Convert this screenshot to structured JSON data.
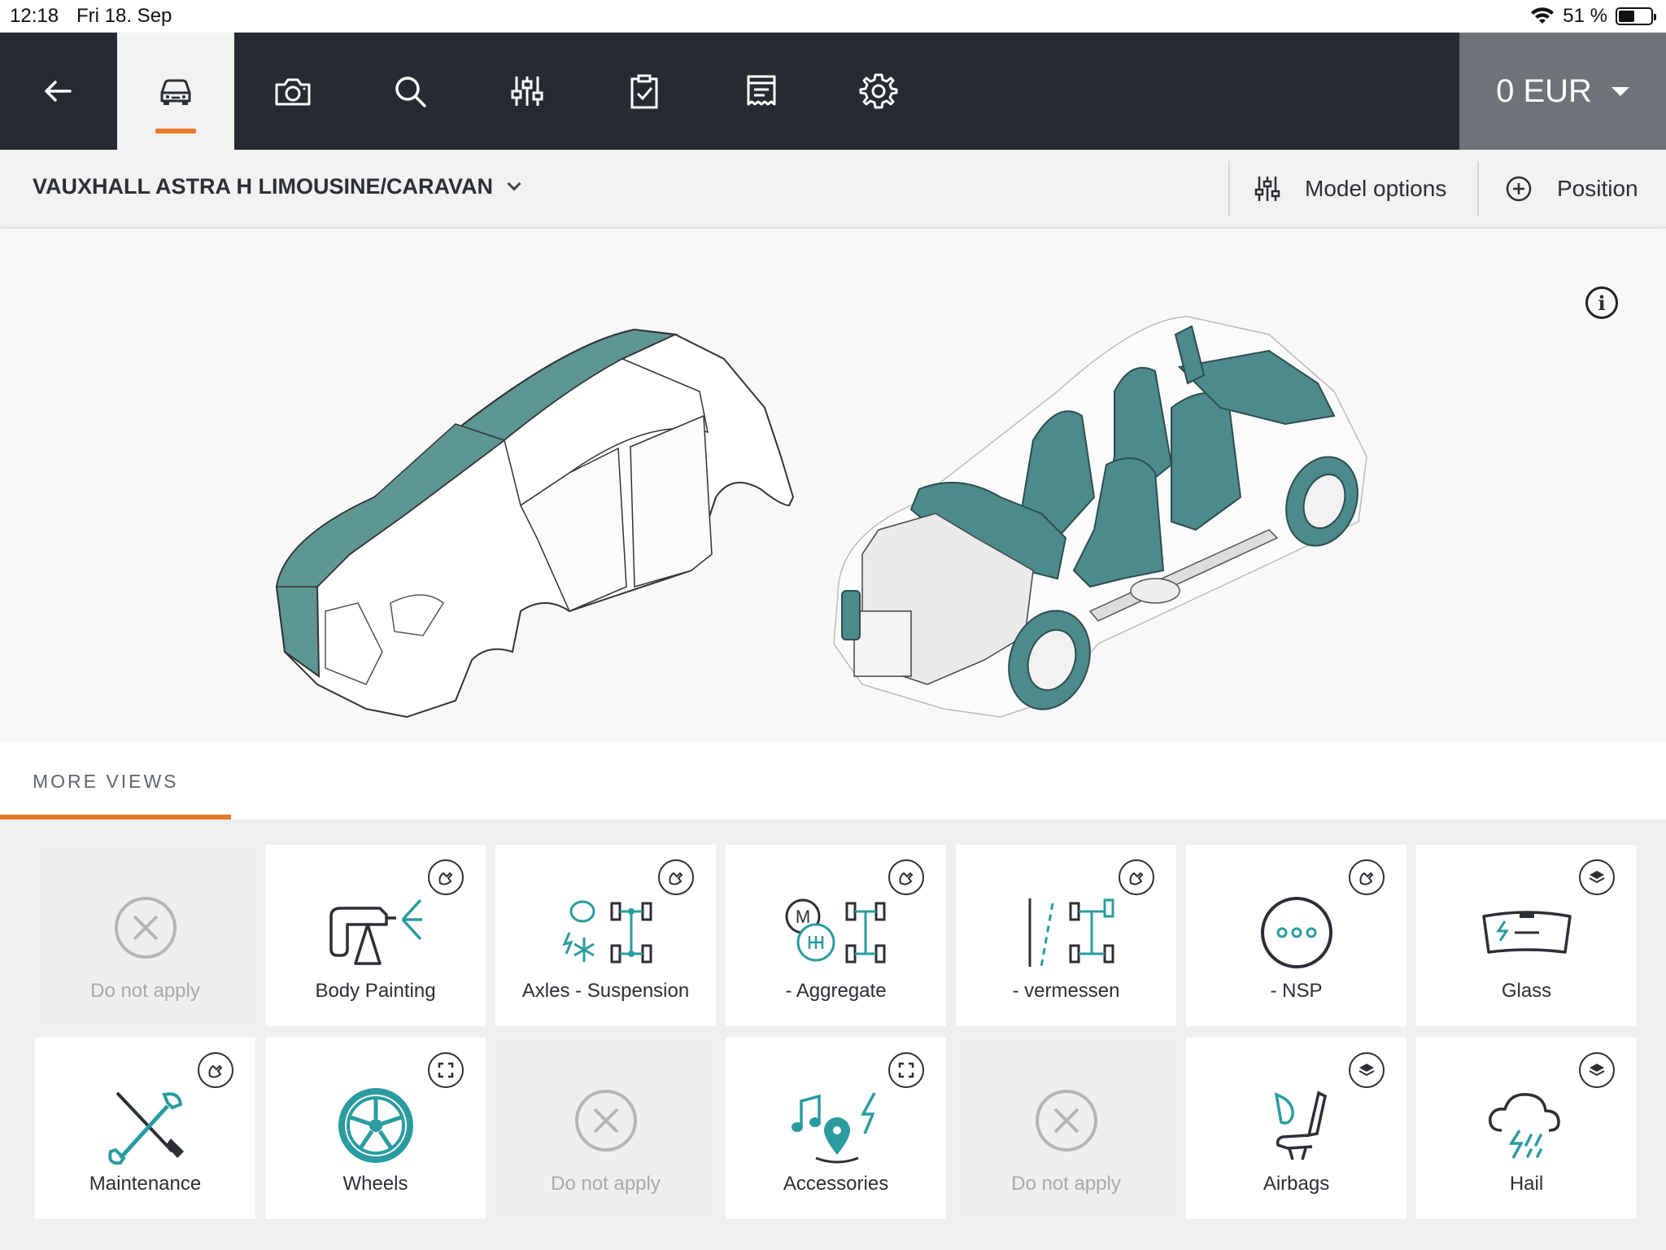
{
  "status_bar": {
    "time": "12:18",
    "date": "Fri 18. Sep",
    "battery": "51 %"
  },
  "toolbar": {
    "buttons": [
      "back-arrow-icon",
      "car-icon",
      "camera-icon",
      "search-icon",
      "sliders-icon",
      "clipboard-check-icon",
      "receipt-icon",
      "gear-icon"
    ],
    "active": "car-icon",
    "price": "0 EUR"
  },
  "model_bar": {
    "title": "VAUXHALL ASTRA H LIMOUSINE/CARAVAN",
    "model_options": "Model options",
    "position": "Position"
  },
  "colors": {
    "accent": "#e8782a",
    "teal": "#2a8c93",
    "toolbar_bg": "#252a33",
    "price_bg": "#6d7379"
  },
  "more_views": {
    "label": "MORE VIEWS",
    "tiles": [
      {
        "label": "Do not apply",
        "enabled": false,
        "icon": "x-circle-icon"
      },
      {
        "label": "Body Painting",
        "enabled": true,
        "icon": "spray-gun-icon",
        "badge": "wrench-badge-icon"
      },
      {
        "label": "Axles - Suspension",
        "enabled": true,
        "icon": "axle-icon",
        "badge": "wrench-badge-icon"
      },
      {
        "label": "- Aggregate",
        "enabled": true,
        "icon": "gearbox-icon",
        "badge": "wrench-badge-icon"
      },
      {
        "label": "- vermessen",
        "enabled": true,
        "icon": "alignment-icon",
        "badge": "wrench-badge-icon"
      },
      {
        "label": "- NSP",
        "enabled": true,
        "icon": "dots-circle-icon",
        "badge": "wrench-badge-icon"
      },
      {
        "label": "Glass",
        "enabled": true,
        "icon": "windshield-icon",
        "badge": "layers-badge-icon"
      },
      {
        "label": "Maintenance",
        "enabled": true,
        "icon": "tools-icon",
        "badge": "wrench-badge-icon"
      },
      {
        "label": "Wheels",
        "enabled": true,
        "icon": "wheel-icon",
        "badge": "expand-badge-icon"
      },
      {
        "label": "Do not apply",
        "enabled": false,
        "icon": "x-circle-icon"
      },
      {
        "label": "Accessories",
        "enabled": true,
        "icon": "accessories-icon",
        "badge": "expand-badge-icon"
      },
      {
        "label": "Do not apply",
        "enabled": false,
        "icon": "x-circle-icon"
      },
      {
        "label": "Airbags",
        "enabled": true,
        "icon": "airbag-seat-icon",
        "badge": "layers-badge-icon"
      },
      {
        "label": "Hail",
        "enabled": true,
        "icon": "hail-cloud-icon",
        "badge": "layers-badge-icon"
      }
    ]
  }
}
